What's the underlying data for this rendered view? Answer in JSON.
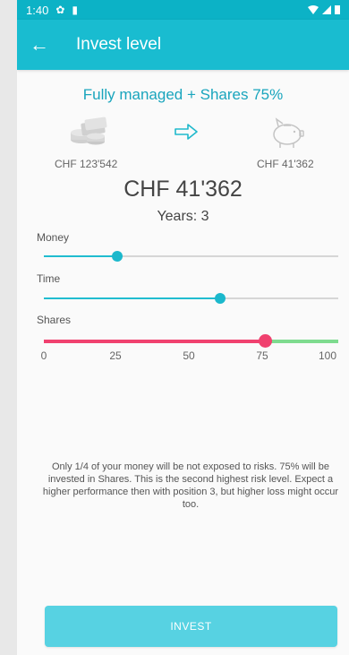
{
  "status_bar": {
    "time": "1:40"
  },
  "app_bar": {
    "title": "Invest level"
  },
  "plan": {
    "title": "Fully managed + Shares 75%"
  },
  "amounts": {
    "start": "CHF 123'542",
    "end": "CHF 41'362",
    "big": "CHF 41'362"
  },
  "years_text": "Years: 3",
  "sliders": {
    "money": {
      "label": "Money",
      "value": 0.25
    },
    "time": {
      "label": "Time",
      "value": 0.6
    },
    "shares": {
      "label": "Shares",
      "value": 75,
      "ticks": [
        "0",
        "25",
        "50",
        "75",
        "100"
      ]
    }
  },
  "description": "Only 1/4 of your money will be not exposed to risks. 75% will be invested in Shares. This is the second highest risk level. Expect a higher performance then with position 3, but higher loss might occur too.",
  "invest_button": {
    "label": "INVEST"
  },
  "colors": {
    "primary": "#19bcd0",
    "accent_pink": "#f0416f",
    "track_green": "#7edb8f"
  },
  "icons": {
    "back": "arrow-left-icon",
    "money": "money-stack-icon",
    "arrow": "arrow-right-icon",
    "pig": "piggy-bank-icon"
  }
}
